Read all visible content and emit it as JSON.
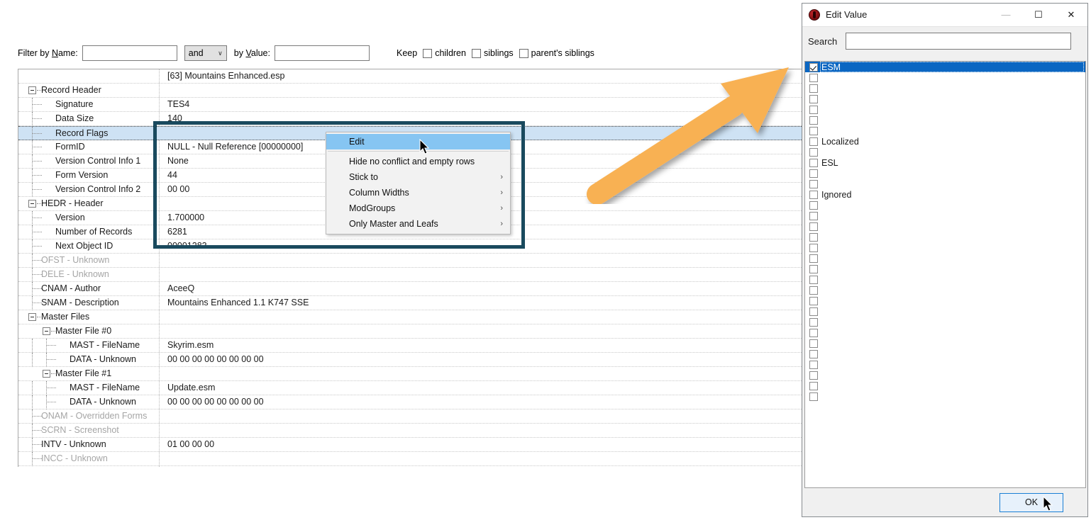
{
  "filter_bar": {
    "name_label": "Filter by Name:",
    "name_value": "",
    "operator": "and",
    "operator_caret": "∨",
    "value_label": "by Value:",
    "value_value": "",
    "keep_label": "Keep",
    "checkboxes": [
      {
        "label": "children",
        "checked": false
      },
      {
        "label": "siblings",
        "checked": false
      },
      {
        "label": "parent's siblings",
        "checked": false
      }
    ]
  },
  "grid": {
    "column_header_value": "[63] Mountains Enhanced.esp",
    "rows": [
      {
        "name": "",
        "value": "[63] Mountains Enhanced.esp",
        "depth": 0,
        "style": "plain"
      },
      {
        "name": "Record Header",
        "value": "",
        "depth": 0,
        "style": "expander"
      },
      {
        "name": "Signature",
        "value": "TES4",
        "depth": 1,
        "style": "leaf"
      },
      {
        "name": "Data Size",
        "value": "140",
        "depth": 1,
        "style": "leaf"
      },
      {
        "name": "Record Flags",
        "value": "",
        "depth": 1,
        "style": "leaf",
        "selected": true
      },
      {
        "name": "FormID",
        "value": "NULL - Null Reference [00000000]",
        "depth": 1,
        "style": "leaf"
      },
      {
        "name": "Version Control Info 1",
        "value": "None",
        "depth": 1,
        "style": "leaf"
      },
      {
        "name": "Form Version",
        "value": "44",
        "depth": 1,
        "style": "leaf"
      },
      {
        "name": "Version Control Info 2",
        "value": "00 00",
        "depth": 1,
        "style": "leaf"
      },
      {
        "name": "HEDR - Header",
        "value": "",
        "depth": 0,
        "style": "expander"
      },
      {
        "name": "Version",
        "value": "1.700000",
        "depth": 1,
        "style": "leaf"
      },
      {
        "name": "Number of Records",
        "value": "6281",
        "depth": 1,
        "style": "leaf"
      },
      {
        "name": "Next Object ID",
        "value": "00001283",
        "depth": 1,
        "style": "leaf"
      },
      {
        "name": "OFST - Unknown",
        "value": "",
        "depth": 0,
        "style": "leaf",
        "dim": true
      },
      {
        "name": "DELE - Unknown",
        "value": "",
        "depth": 0,
        "style": "leaf",
        "dim": true
      },
      {
        "name": "CNAM - Author",
        "value": "AceeQ",
        "depth": 0,
        "style": "leaf"
      },
      {
        "name": "SNAM - Description",
        "value": "Mountains Enhanced 1.1 K747 SSE",
        "depth": 0,
        "style": "leaf"
      },
      {
        "name": "Master Files",
        "value": "",
        "depth": 0,
        "style": "expander"
      },
      {
        "name": "Master File #0",
        "value": "",
        "depth": 1,
        "style": "expander"
      },
      {
        "name": "MAST - FileName",
        "value": "Skyrim.esm",
        "depth": 2,
        "style": "leaf"
      },
      {
        "name": "DATA - Unknown",
        "value": "00 00 00 00 00 00 00 00",
        "depth": 2,
        "style": "leaf"
      },
      {
        "name": "Master File #1",
        "value": "",
        "depth": 1,
        "style": "expander"
      },
      {
        "name": "MAST - FileName",
        "value": "Update.esm",
        "depth": 2,
        "style": "leaf"
      },
      {
        "name": "DATA - Unknown",
        "value": "00 00 00 00 00 00 00 00",
        "depth": 2,
        "style": "leaf"
      },
      {
        "name": "ONAM - Overridden Forms",
        "value": "",
        "depth": 0,
        "style": "leaf",
        "dim": true
      },
      {
        "name": "SCRN - Screenshot",
        "value": "",
        "depth": 0,
        "style": "leaf",
        "dim": true
      },
      {
        "name": "INTV - Unknown",
        "value": "01 00 00 00",
        "depth": 0,
        "style": "leaf"
      },
      {
        "name": "INCC - Unknown",
        "value": "",
        "depth": 0,
        "style": "leaf",
        "dim": true
      }
    ]
  },
  "context_menu": {
    "items": [
      {
        "label": "Edit",
        "highlighted": true,
        "submenu": false,
        "separator_after": true
      },
      {
        "label": "Hide no conflict and empty rows",
        "highlighted": false,
        "submenu": false
      },
      {
        "label": "Stick to",
        "highlighted": false,
        "submenu": true
      },
      {
        "label": "Column Widths",
        "highlighted": false,
        "submenu": true
      },
      {
        "label": "ModGroups",
        "highlighted": false,
        "submenu": true
      },
      {
        "label": "Only Master and Leafs",
        "highlighted": false,
        "submenu": true
      }
    ],
    "submenu_glyph": "›"
  },
  "dialog": {
    "title": "Edit Value",
    "icon": "xedit-app-icon",
    "minimize_glyph": "—",
    "maximize_glyph": "☐",
    "close_glyph": "✕",
    "search_label": "Search",
    "search_value": "",
    "search_placeholder": "",
    "ok_label": "OK",
    "flags": [
      {
        "label": "ESM",
        "checked": true,
        "selected": true
      },
      {
        "label": "",
        "checked": false
      },
      {
        "label": "",
        "checked": false
      },
      {
        "label": "",
        "checked": false
      },
      {
        "label": "",
        "checked": false
      },
      {
        "label": "",
        "checked": false
      },
      {
        "label": "",
        "checked": false
      },
      {
        "label": "Localized",
        "checked": false
      },
      {
        "label": "",
        "checked": false
      },
      {
        "label": "ESL",
        "checked": false
      },
      {
        "label": "",
        "checked": false
      },
      {
        "label": "",
        "checked": false
      },
      {
        "label": "Ignored",
        "checked": false
      },
      {
        "label": "",
        "checked": false
      },
      {
        "label": "",
        "checked": false
      },
      {
        "label": "",
        "checked": false
      },
      {
        "label": "",
        "checked": false
      },
      {
        "label": "",
        "checked": false
      },
      {
        "label": "",
        "checked": false
      },
      {
        "label": "",
        "checked": false
      },
      {
        "label": "",
        "checked": false
      },
      {
        "label": "",
        "checked": false
      },
      {
        "label": "",
        "checked": false
      },
      {
        "label": "",
        "checked": false
      },
      {
        "label": "",
        "checked": false
      },
      {
        "label": "",
        "checked": false
      },
      {
        "label": "",
        "checked": false
      },
      {
        "label": "",
        "checked": false
      },
      {
        "label": "",
        "checked": false
      },
      {
        "label": "",
        "checked": false
      },
      {
        "label": "",
        "checked": false
      },
      {
        "label": "",
        "checked": false
      }
    ]
  },
  "annotations": {
    "arrow_color": "#f8b153",
    "highlight_box_color": "#1a4a5e",
    "selection_color": "#cee2f4",
    "menu_highlight_color": "#86c5f2",
    "list_selection_color": "#0a66c2"
  }
}
